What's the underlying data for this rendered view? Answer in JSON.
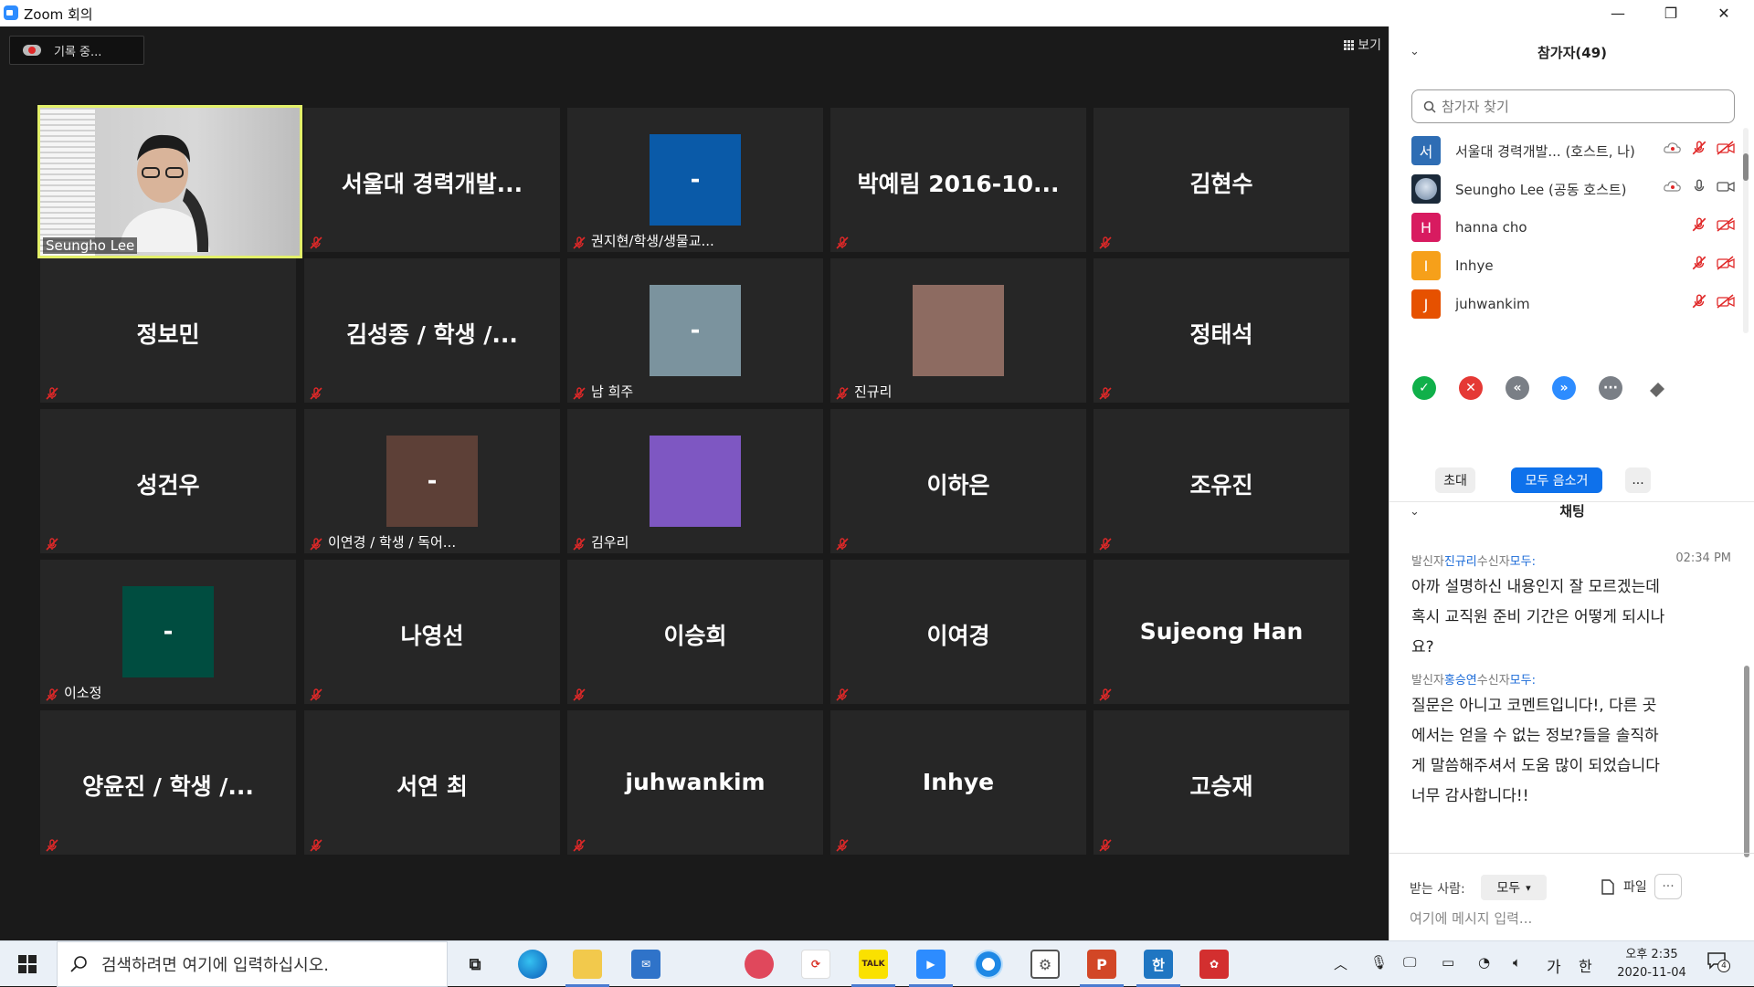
{
  "window": {
    "title": "Zoom 회의",
    "minimize": "—",
    "restore": "❐",
    "close": "✕"
  },
  "meeting": {
    "recording_label": "기록 중...",
    "view_label": "보기"
  },
  "tiles": [
    {
      "type": "video",
      "label": "Seungho Lee"
    },
    {
      "type": "name",
      "name": "서울대 경력개발..."
    },
    {
      "type": "avatar",
      "avatar_text": "-",
      "color": "#0a5aa8",
      "label": "권지현/학생/생물교..."
    },
    {
      "type": "name",
      "name": "박예림 2016-10..."
    },
    {
      "type": "name",
      "name": "김현수"
    },
    {
      "type": "name",
      "name": "정보민"
    },
    {
      "type": "name",
      "name": "김성종 / 학생 /..."
    },
    {
      "type": "avatar",
      "avatar_text": "-",
      "color": "#7b939e",
      "label": "남 희주"
    },
    {
      "type": "avatar",
      "avatar_text": "",
      "color": "#8d6b61",
      "label": "진규리"
    },
    {
      "type": "name",
      "name": "정태석"
    },
    {
      "type": "name",
      "name": "성건우"
    },
    {
      "type": "avatar",
      "avatar_text": "-",
      "color": "#5d4037",
      "label": "이연경 / 학생 / 독어..."
    },
    {
      "type": "avatar",
      "avatar_text": "",
      "color": "#7e57c2",
      "label": "김우리"
    },
    {
      "type": "name",
      "name": "이하은"
    },
    {
      "type": "name",
      "name": "조유진"
    },
    {
      "type": "avatar",
      "avatar_text": "-",
      "color": "#004d40",
      "label": "이소정"
    },
    {
      "type": "name",
      "name": "나영선"
    },
    {
      "type": "name",
      "name": "이승희"
    },
    {
      "type": "name",
      "name": "이여경"
    },
    {
      "type": "name",
      "name": "Sujeong Han"
    },
    {
      "type": "name",
      "name": "양윤진 / 학생 /..."
    },
    {
      "type": "name",
      "name": "서연 최"
    },
    {
      "type": "name",
      "name": "juhwankim"
    },
    {
      "type": "name",
      "name": "Inhye"
    },
    {
      "type": "name",
      "name": "고승재"
    }
  ],
  "participants_panel": {
    "title": "참가자(49)",
    "search_placeholder": "참가자 찾기",
    "participants": [
      {
        "initial": "서",
        "color": "#2e6db4",
        "name": "서울대 경력개발... (호스트, 나)"
      },
      {
        "initial": "",
        "color": "#1b2a3a",
        "name": "Seungho Lee (공동 호스트)"
      },
      {
        "initial": "H",
        "color": "#d81b60",
        "name": "hanna cho"
      },
      {
        "initial": "I",
        "color": "#f6a01a",
        "name": "Inhye"
      },
      {
        "initial": "J",
        "color": "#e65100",
        "name": "juhwankim"
      }
    ],
    "invite_label": "초대",
    "mute_all_label": "모두 음소거",
    "more_label": "..."
  },
  "chat": {
    "title": "채팅",
    "sender_prefix": "발신자",
    "recipient_prefix": "수신자",
    "messages": [
      {
        "sender": "진규리",
        "recipient": "모두:",
        "time": "02:34 PM",
        "lines": [
          "아까 설명하신 내용인지 잘 모르겠는데",
          "혹시 교직원 준비 기간은 어떻게 되시나",
          "요?"
        ]
      },
      {
        "sender": "홍승연",
        "recipient": "모두:",
        "time": "",
        "lines": [
          "질문은 아니고 코멘트입니다!, 다른 곳",
          "에서는 얻을 수 없는 정보?들을 솔직하",
          "게 말씀해주셔서 도움 많이 되었습니다",
          "너무 감사합니다!!"
        ]
      }
    ],
    "to_label": "받는 사람:",
    "to_value": "모두",
    "file_label": "파일",
    "more_label": "···",
    "input_placeholder": "여기에 메시지 입력..."
  },
  "taskbar": {
    "search_placeholder": "검색하려면 여기에 입력하십시오.",
    "ime_ga": "가",
    "ime_han": "한",
    "clock_time": "오후 2:35",
    "clock_date": "2020-11-04",
    "notification_count": "4",
    "kakao_label": "TALK",
    "hancom_label": "한"
  }
}
